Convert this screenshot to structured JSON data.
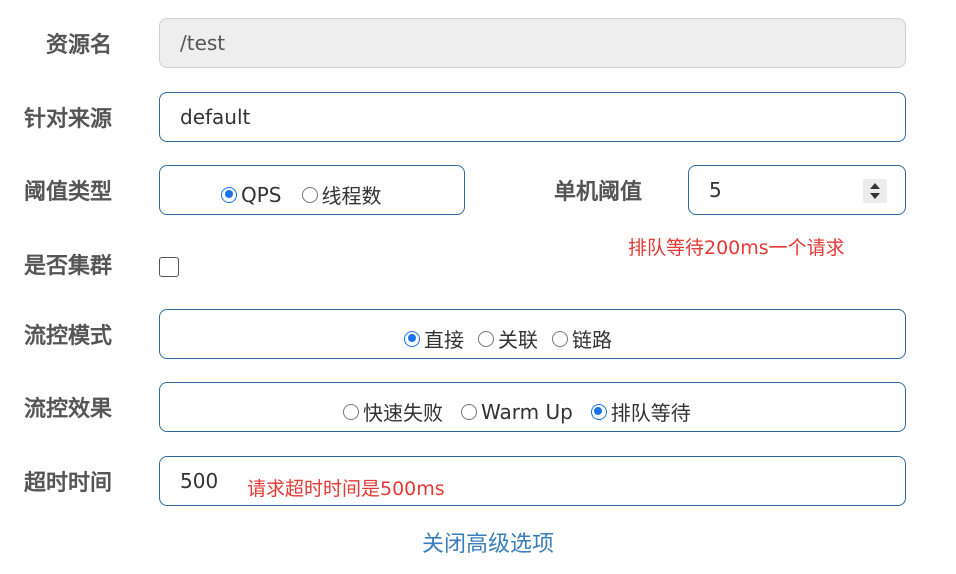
{
  "form": {
    "resource_name": {
      "label": "资源名",
      "value": "/test"
    },
    "source": {
      "label": "针对来源",
      "value": "default"
    },
    "threshold_type": {
      "label": "阈值类型",
      "options": [
        {
          "label": "QPS",
          "checked": true
        },
        {
          "label": "线程数",
          "checked": false
        }
      ]
    },
    "single_threshold": {
      "label": "单机阈值",
      "value": "5"
    },
    "cluster": {
      "label": "是否集群",
      "checked": false
    },
    "flow_mode": {
      "label": "流控模式",
      "options": [
        {
          "label": "直接",
          "checked": true
        },
        {
          "label": "关联",
          "checked": false
        },
        {
          "label": "链路",
          "checked": false
        }
      ]
    },
    "flow_effect": {
      "label": "流控效果",
      "options": [
        {
          "label": "快速失败",
          "checked": false
        },
        {
          "label": "Warm Up",
          "checked": false
        },
        {
          "label": "排队等待",
          "checked": true
        }
      ]
    },
    "timeout": {
      "label": "超时时间",
      "value": "500"
    },
    "close_advanced": "关闭高级选项"
  },
  "annotations": {
    "queue_note": "排队等待200ms一个请求",
    "timeout_note": "请求超时时间是500ms"
  },
  "colors": {
    "accent": "#1a73e8",
    "border": "#2f6aa3",
    "annotation": "#e53935",
    "link": "#3a7dbd"
  }
}
